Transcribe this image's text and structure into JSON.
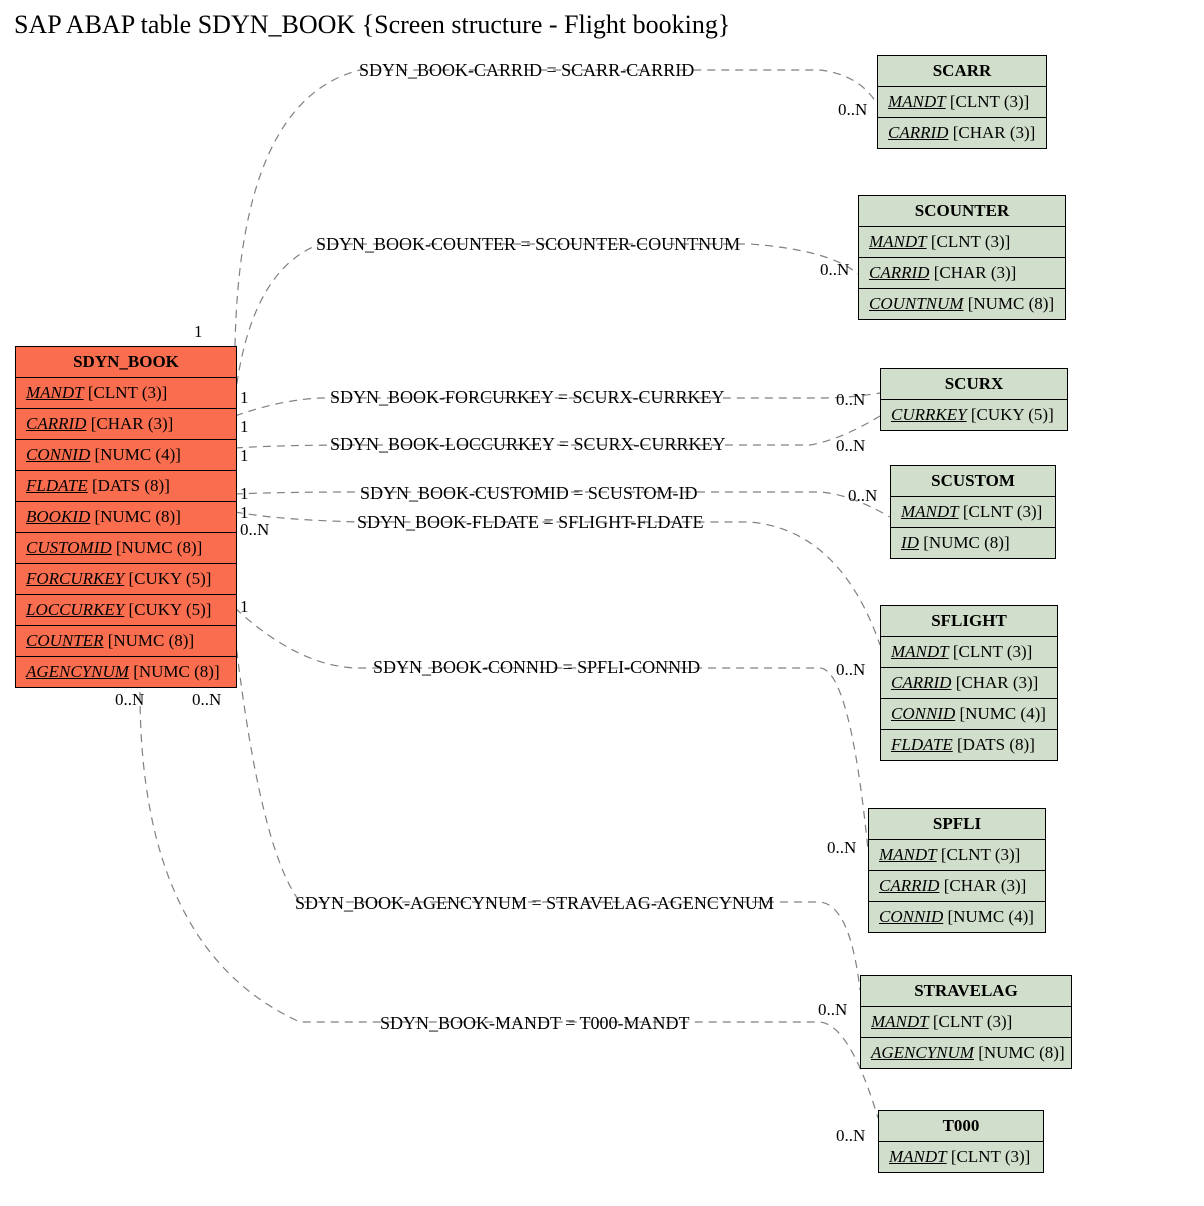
{
  "title": "SAP ABAP table SDYN_BOOK {Screen structure - Flight booking}",
  "main": {
    "name": "SDYN_BOOK",
    "fields": [
      {
        "key": "MANDT",
        "type": "[CLNT (3)]"
      },
      {
        "key": "CARRID",
        "type": "[CHAR (3)]"
      },
      {
        "key": "CONNID",
        "type": "[NUMC (4)]"
      },
      {
        "key": "FLDATE",
        "type": "[DATS (8)]"
      },
      {
        "key": "BOOKID",
        "type": "[NUMC (8)]"
      },
      {
        "key": "CUSTOMID",
        "type": "[NUMC (8)]"
      },
      {
        "key": "FORCURKEY",
        "type": "[CUKY (5)]"
      },
      {
        "key": "LOCCURKEY",
        "type": "[CUKY (5)]"
      },
      {
        "key": "COUNTER",
        "type": "[NUMC (8)]"
      },
      {
        "key": "AGENCYNUM",
        "type": "[NUMC (8)]"
      }
    ]
  },
  "refs": [
    {
      "name": "SCARR",
      "fields": [
        {
          "key": "MANDT",
          "type": "[CLNT (3)]"
        },
        {
          "key": "CARRID",
          "type": "[CHAR (3)]"
        }
      ]
    },
    {
      "name": "SCOUNTER",
      "fields": [
        {
          "key": "MANDT",
          "type": "[CLNT (3)]"
        },
        {
          "key": "CARRID",
          "type": "[CHAR (3)]"
        },
        {
          "key": "COUNTNUM",
          "type": "[NUMC (8)]"
        }
      ]
    },
    {
      "name": "SCURX",
      "fields": [
        {
          "key": "CURRKEY",
          "type": "[CUKY (5)]"
        }
      ]
    },
    {
      "name": "SCUSTOM",
      "fields": [
        {
          "key": "MANDT",
          "type": "[CLNT (3)]"
        },
        {
          "key": "ID",
          "type": "[NUMC (8)]"
        }
      ]
    },
    {
      "name": "SFLIGHT",
      "fields": [
        {
          "key": "MANDT",
          "type": "[CLNT (3)]"
        },
        {
          "key": "CARRID",
          "type": "[CHAR (3)]"
        },
        {
          "key": "CONNID",
          "type": "[NUMC (4)]"
        },
        {
          "key": "FLDATE",
          "type": "[DATS (8)]"
        }
      ]
    },
    {
      "name": "SPFLI",
      "fields": [
        {
          "key": "MANDT",
          "type": "[CLNT (3)]"
        },
        {
          "key": "CARRID",
          "type": "[CHAR (3)]"
        },
        {
          "key": "CONNID",
          "type": "[NUMC (4)]"
        }
      ]
    },
    {
      "name": "STRAVELAG",
      "fields": [
        {
          "key": "MANDT",
          "type": "[CLNT (3)]"
        },
        {
          "key": "AGENCYNUM",
          "type": "[NUMC (8)]"
        }
      ]
    },
    {
      "name": "T000",
      "fields": [
        {
          "key": "MANDT",
          "type": "[CLNT (3)]"
        }
      ]
    }
  ],
  "rels": [
    {
      "label": "SDYN_BOOK-CARRID = SCARR-CARRID",
      "lc": "1",
      "rc": "0..N"
    },
    {
      "label": "SDYN_BOOK-COUNTER = SCOUNTER-COUNTNUM",
      "lc": "1",
      "rc": "0..N"
    },
    {
      "label": "SDYN_BOOK-FORCURKEY = SCURX-CURRKEY",
      "lc": "1",
      "rc": "0..N"
    },
    {
      "label": "SDYN_BOOK-LOCCURKEY = SCURX-CURRKEY",
      "lc": "1",
      "rc": "0..N"
    },
    {
      "label": "SDYN_BOOK-CUSTOMID = SCUSTOM-ID",
      "lc": "1",
      "rc": "0..N"
    },
    {
      "label": "SDYN_BOOK-FLDATE = SFLIGHT-FLDATE",
      "lc": "1",
      "rc": "0..N"
    },
    {
      "label": "SDYN_BOOK-CONNID = SPFLI-CONNID",
      "lc": "0..N",
      "rc": "0..N"
    },
    {
      "label": "SDYN_BOOK-AGENCYNUM = STRAVELAG-AGENCYNUM",
      "lc": "1",
      "rc": "0..N"
    },
    {
      "label": "SDYN_BOOK-MANDT = T000-MANDT",
      "lc": "0..N",
      "rc": "0..N"
    }
  ]
}
